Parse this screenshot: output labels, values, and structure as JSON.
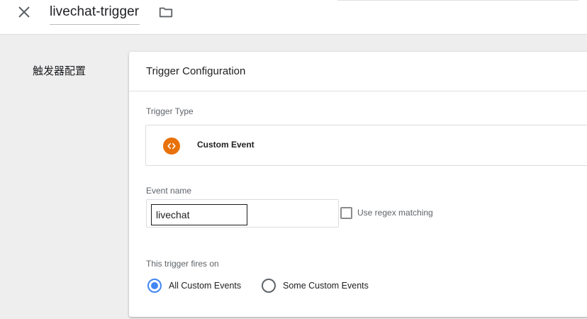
{
  "header": {
    "trigger_name": "livechat-trigger",
    "close_icon": "close-icon",
    "folder_icon": "folder-icon"
  },
  "section": {
    "label": "触发器配置"
  },
  "card": {
    "title": "Trigger Configuration",
    "trigger_type": {
      "label": "Trigger Type",
      "name": "Custom Event",
      "icon": "custom-event-icon",
      "icon_color": "#e8710a"
    },
    "event_name": {
      "label": "Event name",
      "value": "livechat"
    },
    "regex": {
      "label": "Use regex matching",
      "checked": false
    },
    "fires_on": {
      "label": "This trigger fires on",
      "options": [
        {
          "label": "All Custom Events",
          "selected": true
        },
        {
          "label": "Some Custom Events",
          "selected": false
        }
      ]
    }
  },
  "colors": {
    "accent": "#4285f4",
    "page_background": "#eeeeee"
  }
}
